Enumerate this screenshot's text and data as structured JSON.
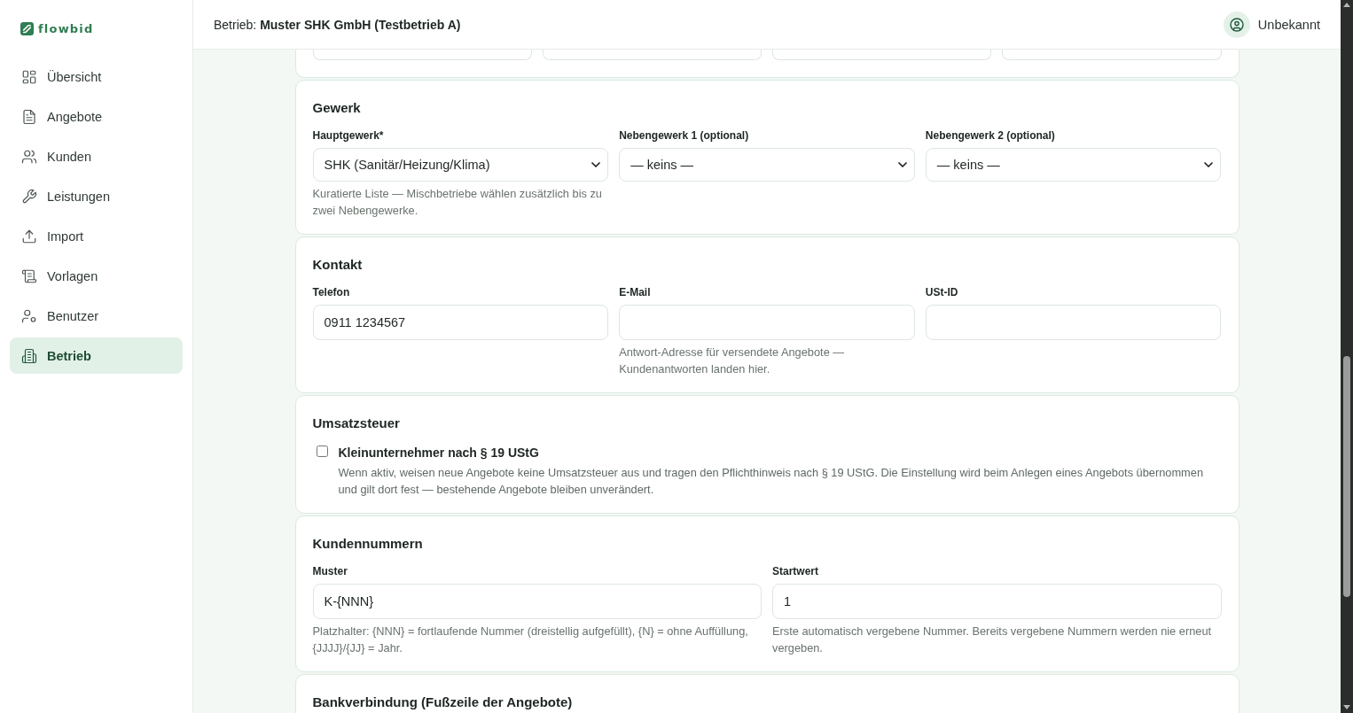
{
  "sidebar": {
    "logo": "flowbid",
    "items": [
      {
        "label": "Übersicht",
        "selected": false
      },
      {
        "label": "Angebote",
        "selected": false
      },
      {
        "label": "Kunden",
        "selected": false
      },
      {
        "label": "Leistungen",
        "selected": false
      },
      {
        "label": "Import",
        "selected": false
      },
      {
        "label": "Vorlagen",
        "selected": false
      },
      {
        "label": "Benutzer",
        "selected": false
      },
      {
        "label": "Betrieb",
        "selected": true
      }
    ]
  },
  "header": {
    "business": "Betrieb: **Muster SHK GmbH (Testbetrieb A)**",
    "user": "Unbekannt"
  },
  "sections": [
    {
      "kind": "partial",
      "fields": [
        {
          "kind": "input"
        },
        {
          "kind": "input"
        },
        {
          "kind": "input"
        },
        {
          "kind": "input"
        }
      ]
    },
    {
      "kind": "fields",
      "title": "Gewerk",
      "fields": [
        {
          "kind": "select",
          "label": "Hauptgewerk*",
          "value": "SHK (Sanitär/Heizung/Klima)",
          "hint": "Kuratierte Liste — Mischbetriebe wählen zusätzlich bis zu zwei Nebengewerke."
        },
        {
          "kind": "select",
          "label": "Nebengewerk 1 (optional)",
          "value": "— keins —"
        },
        {
          "kind": "select",
          "label": "Nebengewerk 2 (optional)",
          "value": "— keins —"
        }
      ]
    },
    {
      "kind": "fields",
      "title": "Kontakt",
      "fields": [
        {
          "kind": "input",
          "label": "Telefon",
          "value": "0911 1234567"
        },
        {
          "kind": "input",
          "label": "E-Mail",
          "hint": "Antwort-Adresse für versendete Angebote — Kundenantworten landen hier."
        },
        {
          "kind": "input",
          "label": "USt-ID"
        }
      ]
    },
    {
      "kind": "checkbox",
      "title": "Umsatzsteuer",
      "option": {
        "label": "Kleinunternehmer nach § 19 UStG",
        "checked": false,
        "description": "Wenn aktiv, weisen neue Angebote keine Umsatzsteuer aus und tragen den Pflichthinweis nach § 19 UStG. Die Einstellung wird beim Anlegen eines Angebots übernommen und gilt dort fest — bestehende Angebote bleiben unverändert."
      }
    },
    {
      "kind": "fields",
      "title": "Kundennummern",
      "fields": [
        {
          "kind": "input",
          "label": "Muster",
          "value": "K-{NNN}",
          "hint": "Platzhalter: {NNN} = fortlaufende Nummer (dreistellig aufgefüllt), {N} = ohne Auffüllung, {JJJJ}/{JJ} = Jahr."
        },
        {
          "kind": "input",
          "label": "Startwert",
          "value": "1",
          "hint": "Erste automatisch vergebene Nummer. Bereits vergebene Nummern werden nie erneut vergeben."
        }
      ]
    },
    {
      "kind": "fields",
      "title": "Bankverbindung (Fußzeile der Angebote)"
    }
  ]
}
